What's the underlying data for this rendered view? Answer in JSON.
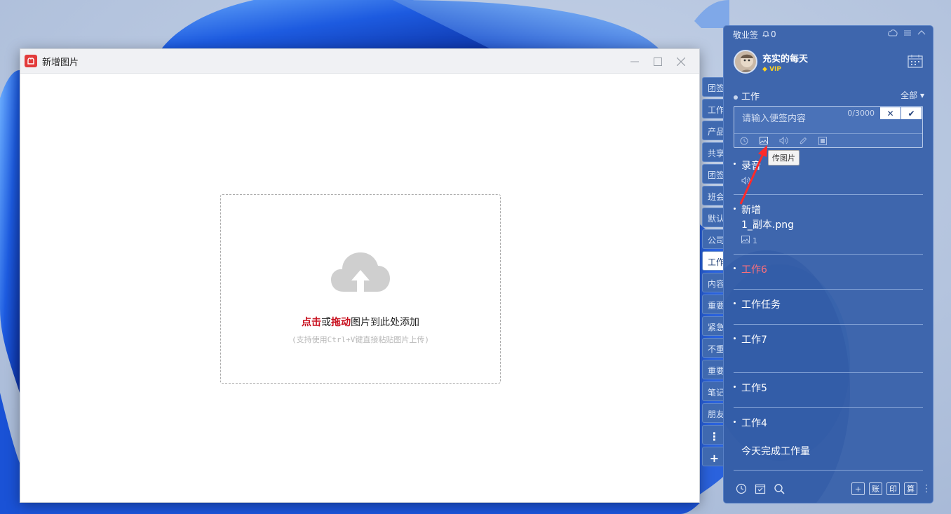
{
  "dialog": {
    "title": "新增图片",
    "dropzone": {
      "click": "点击",
      "or": "或",
      "drag": "拖动",
      "rest": "图片到此处添加",
      "subhint": "(支持使用Ctrl+V键直接粘贴图片上传)"
    }
  },
  "side_tabs": [
    {
      "label": "团签"
    },
    {
      "label": "工作"
    },
    {
      "label": "产品"
    },
    {
      "label": "共享"
    },
    {
      "label": "团签"
    },
    {
      "label": "班会"
    },
    {
      "label": "默认"
    },
    {
      "label": "公司"
    },
    {
      "label": "工作",
      "active": true
    },
    {
      "label": "内容"
    },
    {
      "label": "重要"
    },
    {
      "label": "紧急"
    },
    {
      "label": "不重"
    },
    {
      "label": "重要"
    },
    {
      "label": "笔记"
    },
    {
      "label": "朋友"
    }
  ],
  "side_tools": {
    "more": "⋮",
    "add": "+"
  },
  "panel": {
    "app_name": "敬业签",
    "bell_count": "0",
    "user_name": "充实的每天",
    "vip_label": "VIP",
    "category": "工作",
    "filter": "全部",
    "editor": {
      "placeholder": "请输入便签内容",
      "counter": "0/3000",
      "cancel": "✕",
      "confirm": "✔"
    },
    "tooltip": "传图片",
    "notes": [
      {
        "text": "录音",
        "meta_icon": "audio-icon",
        "meta": ""
      },
      {
        "text": "新增\n1_副本.png",
        "meta_icon": "image-icon",
        "meta": "1"
      },
      {
        "text": "工作6",
        "red": true
      },
      {
        "text": "工作任务"
      },
      {
        "text": "工作7",
        "extra_space": true
      },
      {
        "text": "工作5"
      },
      {
        "text": "工作4\n\n今天完成工作量"
      }
    ],
    "bottom_right": [
      "+",
      "账",
      "印",
      "算"
    ]
  },
  "colors": {
    "panel_bg": "#3e66ad",
    "accent_red": "#c8101e",
    "vip_gold": "#ffd21f",
    "note_red": "#ff6f7a"
  }
}
